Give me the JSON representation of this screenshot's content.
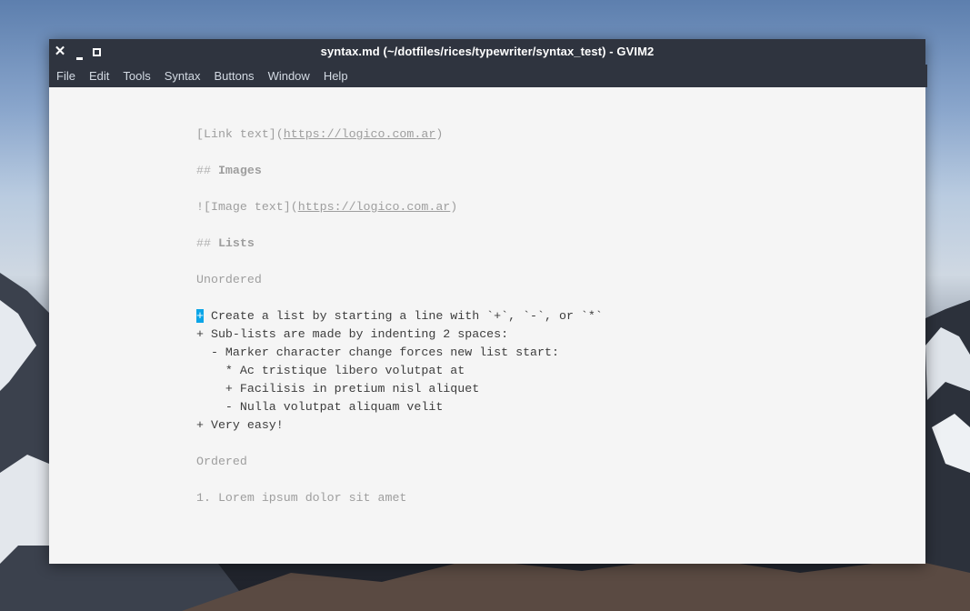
{
  "window": {
    "title": "syntax.md (~/dotfiles/rices/typewriter/syntax_test) - GVIM2"
  },
  "window_controls": {
    "close_icon": "close-icon",
    "minimize_icon": "minimize-icon",
    "maximize_icon": "maximize-icon"
  },
  "menu": [
    "File",
    "Edit",
    "Tools",
    "Syntax",
    "Buttons",
    "Window",
    "Help"
  ],
  "editor": {
    "link_line": {
      "open": "[Link text](",
      "url": "https://logico.com.ar",
      "close": ")"
    },
    "images_heading": {
      "hashes": "##",
      "text": " Images"
    },
    "image_line": {
      "open": "![Image text](",
      "url": "https://logico.com.ar",
      "close": ")"
    },
    "lists_heading": {
      "hashes": "##",
      "text": " Lists"
    },
    "unordered_label": "Unordered",
    "list_line_1": {
      "marker": "+",
      "text": " Create a list by starting a line with `+`, `-`, or `*`"
    },
    "list_line_2": "+ Sub-lists are made by indenting 2 spaces:",
    "list_line_3": "  - Marker character change forces new list start:",
    "list_line_4": "    * Ac tristique libero volutpat at",
    "list_line_5": "    + Facilisis in pretium nisl aliquet",
    "list_line_6": "    - Nulla volutpat aliquam velit",
    "list_line_7": "+ Very easy!",
    "ordered_label": "Ordered",
    "ordered_line_1": "1. Lorem ipsum dolor sit amet"
  },
  "colors": {
    "titlebar": "#2f343f",
    "editor_bg": "#f5f5f5",
    "text": "#3d3d3d",
    "muted": "#9e9e9e",
    "cursor": "#0aa5e8"
  }
}
